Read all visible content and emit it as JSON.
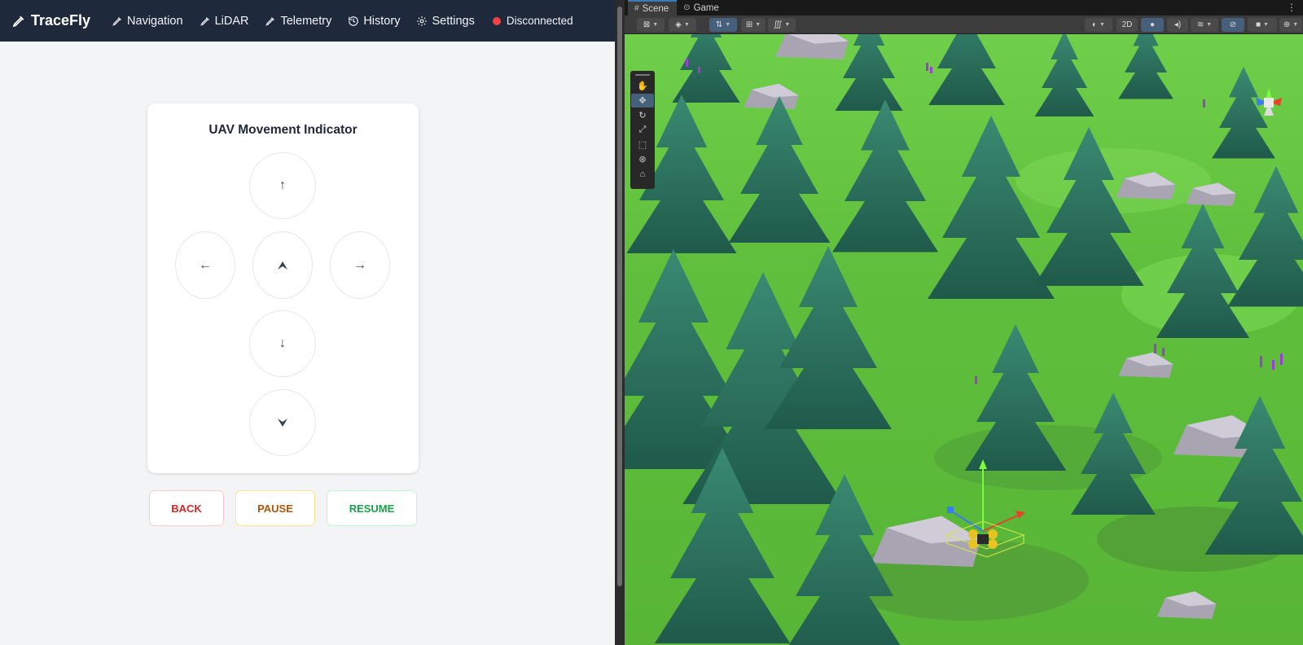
{
  "nav": {
    "brand": "TraceFly",
    "items": [
      {
        "label": "Navigation",
        "icon": "pencil-icon"
      },
      {
        "label": "LiDAR",
        "icon": "pencil-icon"
      },
      {
        "label": "Telemetry",
        "icon": "pencil-icon"
      },
      {
        "label": "History",
        "icon": "history-icon"
      },
      {
        "label": "Settings",
        "icon": "gear-icon"
      }
    ],
    "status": {
      "label": "Disconnected",
      "color": "#ef4444"
    }
  },
  "indicator": {
    "title": "UAV Movement Indicator",
    "up": "↑",
    "left": "←",
    "right": "→",
    "down": "↓"
  },
  "controls": {
    "back": "BACK",
    "pause": "PAUSE",
    "resume": "RESUME"
  },
  "editor": {
    "tabs": [
      {
        "label": "Scene",
        "icon": "grid-icon",
        "active": true
      },
      {
        "label": "Game",
        "icon": "gamepad-icon",
        "active": false
      }
    ],
    "toolbar_2d": "2D",
    "tools": [
      "hand-tool",
      "move-tool",
      "rotate-tool",
      "scale-tool",
      "rect-tool",
      "transform-tool",
      "custom-tool"
    ],
    "active_tool": "move-tool"
  },
  "colors": {
    "nav_bg": "#1e293b",
    "back": "#dc2626",
    "pause": "#b45309",
    "resume": "#16a34a",
    "unity_active": "#46607c"
  }
}
